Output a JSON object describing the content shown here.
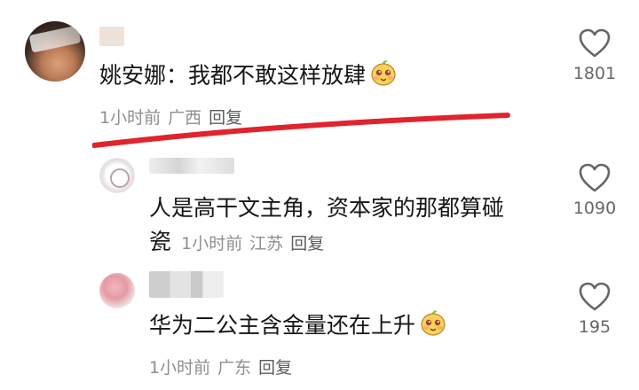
{
  "comments": [
    {
      "text": "姚安娜：我都不敢这样放肆",
      "time": "1小时前",
      "location": "广西",
      "reply_label": "回复",
      "likes": "1801",
      "emoji_icon": "cute-mango-face-icon"
    },
    {
      "text_line1": "人是高干文主角，资本家的那都算碰",
      "text_line2_start": "瓷",
      "time": "1小时前",
      "location": "江苏",
      "reply_label": "回复",
      "likes": "1090"
    },
    {
      "text": "华为二公主含金量还在上升",
      "time": "1小时前",
      "location": "广东",
      "reply_label": "回复",
      "likes": "195",
      "emoji_icon": "cute-mango-face-icon"
    }
  ],
  "colors": {
    "underline": "#e0242e",
    "meta": "#8e8e8e",
    "text": "#151515"
  }
}
